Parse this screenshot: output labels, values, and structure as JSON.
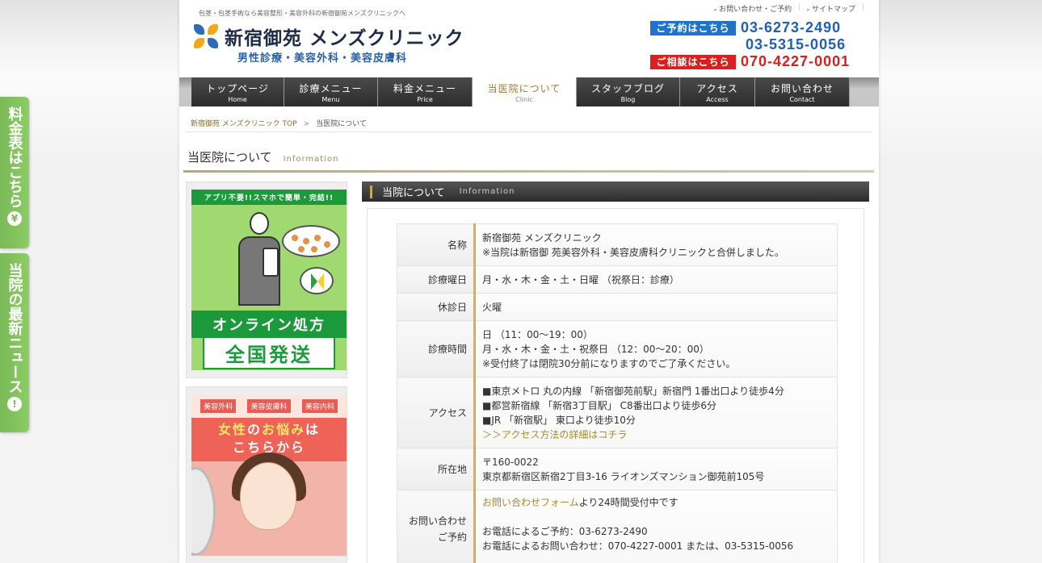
{
  "side_tabs": {
    "price": "料金表はこちら",
    "price_icon": "¥",
    "news": "当院の最新ニュース",
    "news_icon": "!"
  },
  "header": {
    "tagline": "包茎・包茎手術なら美容整形・美容外科の新宿御苑メンズクリニックへ",
    "logo_name": "新宿御苑 メンズクリニック",
    "logo_sub": "男性診療・美容外科・美容皮膚科",
    "top_links": [
      "お問い合わせ・ご予約",
      "サイトマップ"
    ],
    "phones": {
      "reserve_label": "ご予約はこちら",
      "reserve_num1": "03-6273-2490",
      "reserve_num2": "03-5315-0056",
      "consult_label": "ご相談はこちら",
      "consult_num": "070-4227-0001"
    }
  },
  "nav": [
    {
      "jp": "トップページ",
      "en": "Home"
    },
    {
      "jp": "診療メニュー",
      "en": "Menu"
    },
    {
      "jp": "料金メニュー",
      "en": "Price"
    },
    {
      "jp": "当医院について",
      "en": "Clinic"
    },
    {
      "jp": "スタッフブログ",
      "en": "Blog"
    },
    {
      "jp": "アクセス",
      "en": "Access"
    },
    {
      "jp": "お問い合わせ",
      "en": "Contact"
    }
  ],
  "breadcrumb": {
    "home": "新宿御苑 メンズクリニック TOP",
    "sep": ">",
    "current": "当医院について"
  },
  "page_title": {
    "jp": "当医院について",
    "en": "Information"
  },
  "banners": {
    "online": {
      "top": "アプリ不要!!スマホで簡単・完結!!",
      "title": "オンライン処方",
      "big": "全国発送"
    },
    "women": {
      "cats": [
        "美容外科",
        "美容皮膚科",
        "美容内科"
      ],
      "line1_a": "女性",
      "line1_b": "の",
      "line1_c": "お悩み",
      "line1_d": "は",
      "line2": "こちらから"
    }
  },
  "section": {
    "title": "当院について",
    "title_en": "Information",
    "rows": [
      {
        "th": "名称",
        "lines": [
          "新宿御苑 メンズクリニック",
          "※当院は新宿御 苑美容外科・美容皮膚科クリニックと合併しました。"
        ]
      },
      {
        "th": "診療曜日",
        "lines": [
          "月・水・木・金・土・日曜 （祝祭日：診療）"
        ]
      },
      {
        "th": "休診日",
        "lines": [
          "火曜"
        ]
      },
      {
        "th": "診療時間",
        "lines": [
          "日 （11：00〜19：00）",
          "月・水・木・金・土・祝祭日 （12：00〜20：00）",
          "※受付終了は閉院30分前になりますのでご了承ください。"
        ]
      },
      {
        "th": "アクセス",
        "lines": [
          "■東京メトロ 丸の内線 「新宿御苑前駅」新宿門 1番出口より徒歩4分",
          "■都営新宿線 「新宿3丁目駅」 C8番出口より徒歩6分",
          "■JR 「新宿駅」 東口より徒歩10分"
        ],
        "link": "＞＞アクセス方法の詳細はコチラ"
      },
      {
        "th": "所在地",
        "lines": [
          "〒160-0022",
          "東京都新宿区新宿2丁目3-16 ライオンズマンション御苑前105号"
        ]
      },
      {
        "th1": "お問い合わせ",
        "th2": "ご予約",
        "link": "お問い合わせフォーム",
        "link_after": "より24時間受付中です",
        "lines": [
          "お電話によるご予約：03-6273-2490",
          "お電話によるお問い合わせ：070-4227-0001 または、03-5315-0056"
        ]
      }
    ]
  }
}
